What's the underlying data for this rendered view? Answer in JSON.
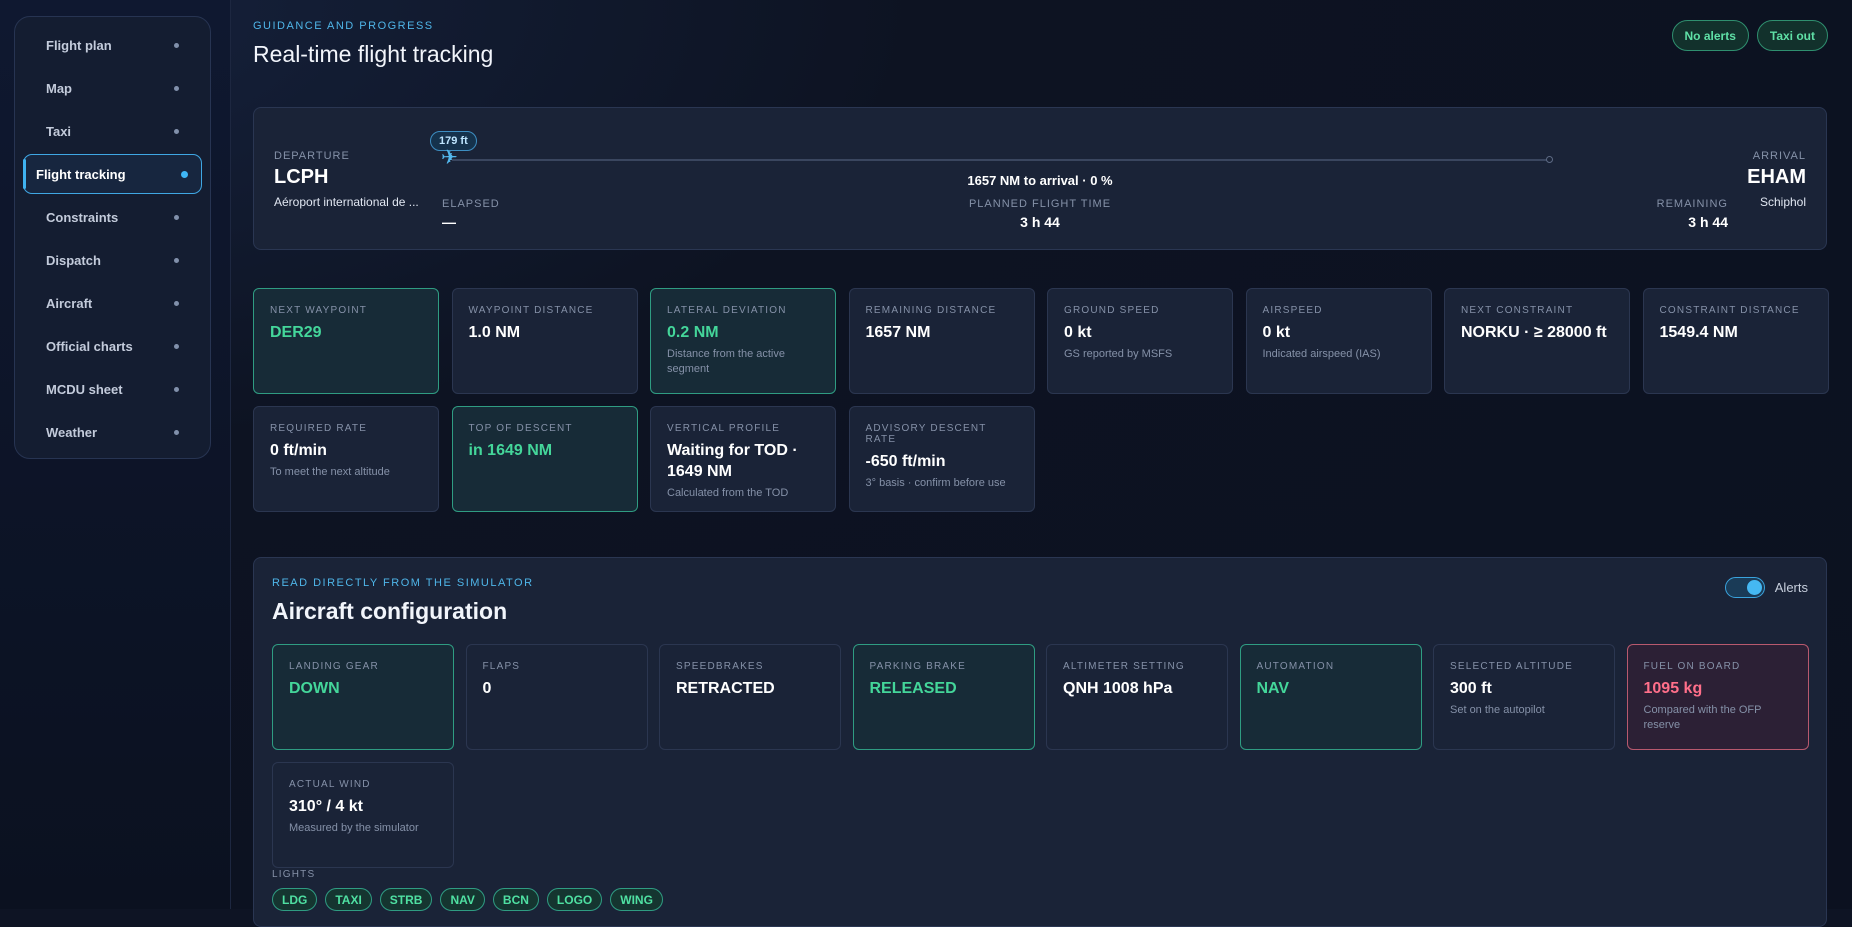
{
  "sidebar": {
    "items": [
      {
        "label": "Flight plan"
      },
      {
        "label": "Map"
      },
      {
        "label": "Taxi"
      },
      {
        "label": "Flight tracking",
        "active": true
      },
      {
        "label": "Constraints"
      },
      {
        "label": "Dispatch"
      },
      {
        "label": "Aircraft"
      },
      {
        "label": "Official charts"
      },
      {
        "label": "MCDU sheet"
      },
      {
        "label": "Weather"
      }
    ]
  },
  "header": {
    "eyebrow": "GUIDANCE AND PROGRESS",
    "title": "Real-time flight tracking",
    "pill_alerts": "No alerts",
    "pill_phase": "Taxi out"
  },
  "progress": {
    "departure_label": "DEPARTURE",
    "departure_code": "LCPH",
    "departure_name": "Aéroport international de ...",
    "arrival_label": "ARRIVAL",
    "arrival_code": "EHAM",
    "arrival_name": "Schiphol",
    "altitude_badge": "179 ft",
    "to_arrival": "1657 NM to arrival · 0 %",
    "progress_fraction": 0.0,
    "elapsed_label": "ELAPSED",
    "elapsed_value": "—",
    "planned_label": "PLANNED FLIGHT TIME",
    "planned_value": "3 h 44",
    "remaining_label": "REMAINING",
    "remaining_value": "3 h 44"
  },
  "metrics": [
    {
      "label": "NEXT WAYPOINT",
      "value": "DER29",
      "sub": "",
      "state": "ok"
    },
    {
      "label": "WAYPOINT DISTANCE",
      "value": "1.0 NM",
      "sub": "",
      "state": ""
    },
    {
      "label": "LATERAL DEVIATION",
      "value": "0.2 NM",
      "sub": "Distance from the active segment",
      "state": "ok"
    },
    {
      "label": "REMAINING DISTANCE",
      "value": "1657 NM",
      "sub": "",
      "state": ""
    },
    {
      "label": "GROUND SPEED",
      "value": "0 kt",
      "sub": "GS reported by MSFS",
      "state": ""
    },
    {
      "label": "AIRSPEED",
      "value": "0 kt",
      "sub": "Indicated airspeed (IAS)",
      "state": ""
    },
    {
      "label": "NEXT CONSTRAINT",
      "value": "NORKU · ≥ 28000 ft",
      "sub": "",
      "state": ""
    },
    {
      "label": "CONSTRAINT DISTANCE",
      "value": "1549.4 NM",
      "sub": "",
      "state": ""
    },
    {
      "label": "REQUIRED RATE",
      "value": "0 ft/min",
      "sub": "To meet the next altitude",
      "state": ""
    },
    {
      "label": "TOP OF DESCENT",
      "value": "in 1649 NM",
      "sub": "",
      "state": "ok"
    },
    {
      "label": "VERTICAL PROFILE",
      "value": "Waiting for TOD · 1649 NM",
      "sub": "Calculated from the TOD",
      "state": ""
    },
    {
      "label": "ADVISORY DESCENT RATE",
      "value": "-650 ft/min",
      "sub": "3° basis · confirm before use",
      "state": ""
    }
  ],
  "config": {
    "eyebrow": "READ DIRECTLY FROM THE SIMULATOR",
    "title": "Aircraft configuration",
    "alerts_label": "Alerts",
    "alerts_on": true,
    "cards": [
      {
        "label": "LANDING GEAR",
        "value": "DOWN",
        "sub": "",
        "state": "ok"
      },
      {
        "label": "FLAPS",
        "value": "0",
        "sub": "",
        "state": ""
      },
      {
        "label": "SPEEDBRAKES",
        "value": "RETRACTED",
        "sub": "",
        "state": ""
      },
      {
        "label": "PARKING BRAKE",
        "value": "RELEASED",
        "sub": "",
        "state": "ok"
      },
      {
        "label": "ALTIMETER SETTING",
        "value": "QNH 1008 hPa",
        "sub": "",
        "state": ""
      },
      {
        "label": "AUTOMATION",
        "value": "NAV",
        "sub": "",
        "state": "ok"
      },
      {
        "label": "SELECTED ALTITUDE",
        "value": "300 ft",
        "sub": "Set on the autopilot",
        "state": ""
      },
      {
        "label": "FUEL ON BOARD",
        "value": "1095 kg",
        "sub": "Compared with the OFP reserve",
        "state": "warn"
      },
      {
        "label": "ACTUAL WIND",
        "value": "310° / 4 kt",
        "sub": "Measured by the simulator",
        "state": ""
      }
    ],
    "lights_label": "LIGHTS",
    "lights": [
      "LDG",
      "TAXI",
      "STRB",
      "NAV",
      "BCN",
      "LOGO",
      "WING"
    ]
  },
  "colors": {
    "accent": "#3fb2f0",
    "ok": "#44d69a",
    "warn": "#ff6f8a",
    "panel": "#1a2337"
  }
}
